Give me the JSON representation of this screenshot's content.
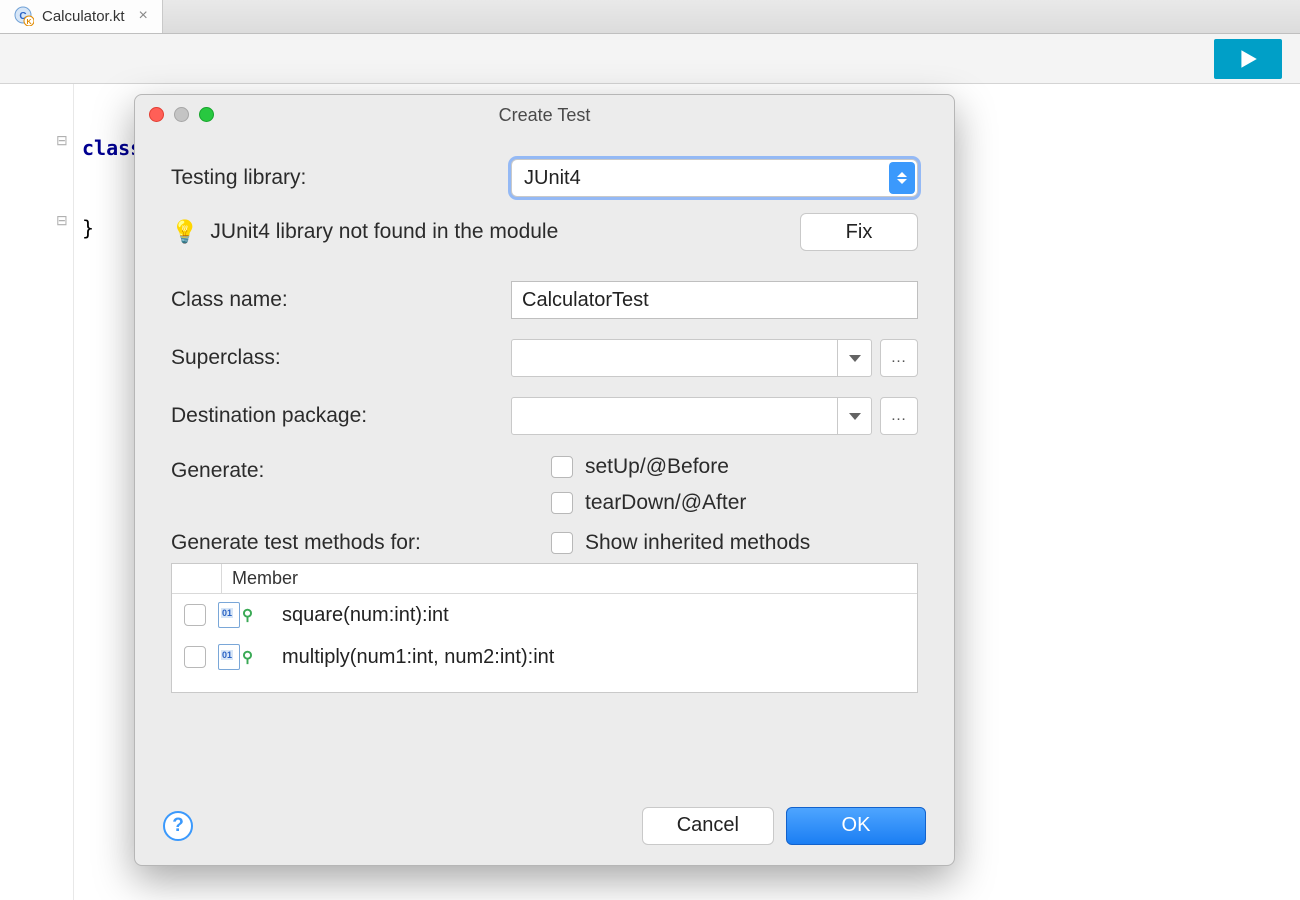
{
  "tab": {
    "filename": "Calculator.kt"
  },
  "editor": {
    "line1_kw": "class",
    "line3": "}"
  },
  "dialog": {
    "title": "Create Test",
    "labels": {
      "testing_library": "Testing library:",
      "class_name": "Class name:",
      "superclass": "Superclass:",
      "destination_pkg": "Destination package:",
      "generate": "Generate:",
      "generate_methods": "Generate test methods for:",
      "member_header": "Member"
    },
    "testing_library_value": "JUnit4",
    "hint": "JUnit4 library not found in the module",
    "fix_label": "Fix",
    "class_name_value": "CalculatorTest",
    "superclass_value": "",
    "destination_pkg_value": "",
    "generate_options": {
      "setup": "setUp/@Before",
      "teardown": "tearDown/@After",
      "show_inherited": "Show inherited methods"
    },
    "members": [
      {
        "sig": "square(num:int):int"
      },
      {
        "sig": "multiply(num1:int, num2:int):int"
      }
    ],
    "buttons": {
      "cancel": "Cancel",
      "ok": "OK"
    }
  }
}
